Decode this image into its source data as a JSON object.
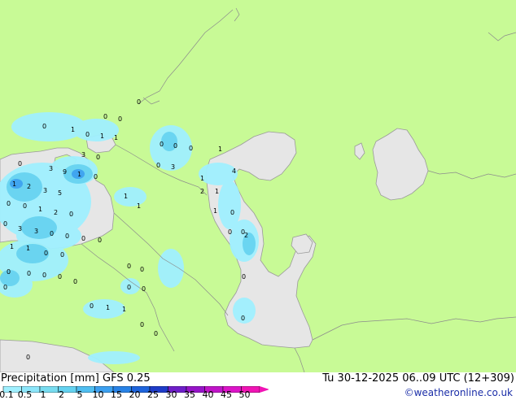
{
  "footer": {
    "title": "Precipitation [mm]  GFS 0.25",
    "valid_time": "Tu 30-12-2025 06..09 UTC (12+309)",
    "credit": "©weatheronline.co.uk"
  },
  "legend": {
    "ticks": [
      "0.1",
      "0.5",
      "1",
      "2",
      "5",
      "10",
      "15",
      "20",
      "25",
      "30",
      "35",
      "40",
      "45",
      "50"
    ],
    "colors": [
      "#a0f0ff",
      "#8ce6fa",
      "#78dcf0",
      "#64d2f0",
      "#50bef0",
      "#3ca0f0",
      "#2882e6",
      "#1e64dc",
      "#1e3cc8",
      "#6e1ec8",
      "#9614c8",
      "#c014c8",
      "#dc14c8",
      "#f014b4"
    ]
  },
  "map": {
    "land_color": "#c8fa96",
    "sea_color": "#e6e6e6",
    "precip_labels": [
      "0",
      "0",
      "0",
      "0",
      "1",
      "0",
      "1",
      "1",
      "0",
      "0",
      "0",
      "1",
      "3",
      "0",
      "0",
      "0",
      "3",
      "9",
      "1",
      "3",
      "0",
      "4",
      "1",
      "1",
      "2",
      "3",
      "5",
      "2",
      "1",
      "1",
      "1",
      "0",
      "0",
      "1",
      "2",
      "0",
      "1",
      "0",
      "0",
      "3",
      "3",
      "0",
      "0",
      "0",
      "0",
      "1",
      "1",
      "0",
      "0",
      "0",
      "0",
      "2",
      "0",
      "0",
      "0",
      "0",
      "0",
      "0",
      "0",
      "0",
      "0",
      "0",
      "0",
      "0",
      "1",
      "1",
      "0",
      "0",
      "0",
      "0"
    ]
  }
}
